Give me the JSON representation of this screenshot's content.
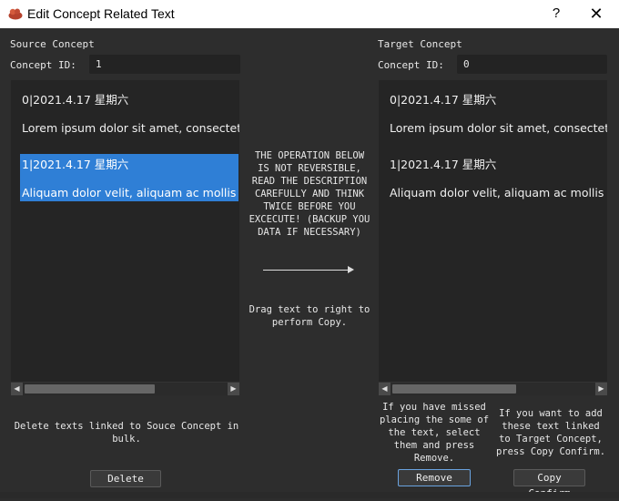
{
  "window": {
    "title": "Edit Concept Related Text",
    "help_label": "?",
    "close_label": "✕",
    "app_icon": "app-logo-icon"
  },
  "source": {
    "heading": "Source Concept",
    "id_label": "Concept ID:",
    "id_value": "1",
    "items": [
      {
        "header": "0|2021.4.17 星期六",
        "body": "Lorem ipsum dolor sit amet, consectetur",
        "selected": false
      },
      {
        "header": "1|2021.4.17 星期六",
        "body": "Aliquam dolor velit, aliquam ac mollis a,",
        "selected": true
      }
    ],
    "delete_hint": "Delete texts linked to Souce Concept in bulk.",
    "delete_button": "Delete"
  },
  "target": {
    "heading": "Target Concept",
    "id_label": "Concept ID:",
    "id_value": "0",
    "items": [
      {
        "header": "0|2021.4.17 星期六",
        "body": "Lorem ipsum dolor sit amet, consectetur"
      },
      {
        "header": "1|2021.4.17 星期六",
        "body": "Aliquam dolor velit, aliquam ac mollis a,"
      }
    ],
    "remove_hint": "If you have missed placing the some of the text, select them and press Remove.",
    "remove_button": "Remove",
    "copy_hint": "If you want to add these text linked to Target Concept, press Copy Confirm.",
    "copy_button": "Copy Confirm"
  },
  "center": {
    "warning": "THE OPERATION BELOW IS NOT REVERSIBLE, READ THE DESCRIPTION CAREFULLY AND THINK TWICE BEFORE YOU EXCECUTE! (BACKUP YOU DATA IF NECESSARY)",
    "drag_hint": "Drag text to right to perform Copy."
  },
  "colors": {
    "background": "#2d2d2d",
    "list_background": "#252525",
    "selection": "#2f7fd6",
    "titlebar": "#ffffff"
  }
}
